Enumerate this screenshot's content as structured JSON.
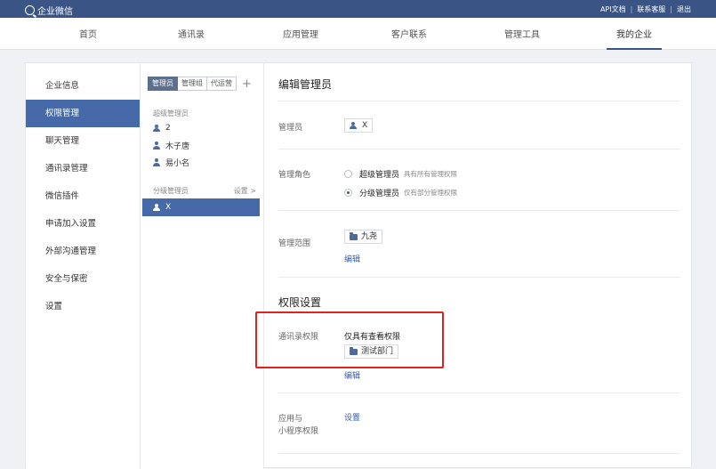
{
  "topbar": {
    "app_name": "企业微信",
    "links": [
      "API文档",
      "联系客服",
      "退出"
    ]
  },
  "nav": {
    "items": [
      "首页",
      "通讯录",
      "应用管理",
      "客户联系",
      "管理工具",
      "我的企业"
    ],
    "active_index": 5
  },
  "sidebar": {
    "items": [
      "企业信息",
      "权限管理",
      "聊天管理",
      "通讯录管理",
      "微信插件",
      "申请加入设置",
      "外部沟通管理",
      "安全与保密",
      "设置"
    ],
    "active_index": 1
  },
  "admin_panel": {
    "tabs": [
      "管理员",
      "管理组",
      "代运营"
    ],
    "add_symbol": "+",
    "super_admin_label": "超级管理员",
    "super_admins": [
      "2",
      "木子唐",
      "易小名"
    ],
    "sub_admin_label": "分级管理员",
    "settings_link": "设置 >",
    "selected_admin": "X"
  },
  "main": {
    "title": "编辑管理员",
    "admin_label": "管理员",
    "admin_value": "X",
    "role_label": "管理角色",
    "roles": [
      {
        "name": "超级管理员",
        "desc": "具有所有管理权限",
        "checked": false
      },
      {
        "name": "分级管理员",
        "desc": "仅有部分管理权限",
        "checked": true
      }
    ],
    "scope_label": "管理范围",
    "scope_value": "九尧",
    "edit_link": "编辑",
    "permissions_title": "权限设置",
    "contacts_perm_label": "通讯录权限",
    "contacts_perm_value": "仅具有查看权限",
    "contacts_dept": "测试部门",
    "contacts_edit_link": "编辑",
    "app_perm_label_line1": "应用与",
    "app_perm_label_line2": "小程序权限",
    "app_perm_link": "设置"
  },
  "colors": {
    "topbar": "#3a5585",
    "active_sidebar": "#4669a8",
    "link": "#3a5da8",
    "highlight": "#e0231f"
  }
}
